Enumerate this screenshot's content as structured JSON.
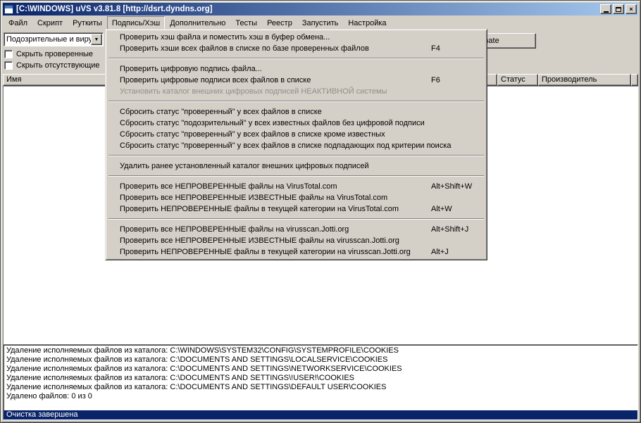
{
  "window": {
    "title": "[C:\\WINDOWS] uVS v3.81.8 [http://dsrt.dyndns.org]"
  },
  "icons": {
    "close": "×",
    "dropdown_arrow": "▼"
  },
  "colors": {
    "window_bg": "#d4d0c8",
    "titlebar_left": "#0a246a",
    "titlebar_right": "#a6caf0",
    "selection": "#0a246a"
  },
  "menubar": {
    "items": [
      "Файл",
      "Скрипт",
      "Руткиты",
      "Подпись/Хэш",
      "Дополнительно",
      "Тесты",
      "Реестр",
      "Запустить",
      "Настройка"
    ],
    "open_item": "Подпись/Хэш"
  },
  "toolbar": {
    "category_value": "Подозрительные и вирусы",
    "hide_checked_label": "Скрыть проверенные",
    "hide_checked_checked": false,
    "hide_missing_label": "Скрыть отсутствующие",
    "hide_missing_checked": false,
    "donate_label": "Donate"
  },
  "list": {
    "columns": [
      "Имя",
      "Статус",
      "Производитель"
    ],
    "rows": []
  },
  "hash_menu": {
    "items": [
      {
        "label": "Проверить хэш файла и поместить хэш в буфер обмена...",
        "shortcut": ""
      },
      {
        "label": "Проверить хэши всех файлов в списке по базе проверенных файлов",
        "shortcut": "F4"
      },
      {
        "label": "Проверить цифровую подпись файла...",
        "shortcut": ""
      },
      {
        "label": "Проверить цифровые подписи всех файлов в списке",
        "shortcut": "F6"
      },
      {
        "label": "Установить каталог внешних цифровых подписей НЕАКТИВНОЙ системы",
        "shortcut": "",
        "disabled": true
      },
      {
        "label": "Сбросить статус \"проверенный\" у всех файлов в списке",
        "shortcut": ""
      },
      {
        "label": "Сбросить статус \"подозрительный\" у всех известных файлов без цифровой подписи",
        "shortcut": ""
      },
      {
        "label": "Сбросить статус \"проверенный\" у всех файлов в списке кроме известных",
        "shortcut": ""
      },
      {
        "label": "Сбросить статус \"проверенный\" у всех файлов в списке подпадающих под критерии поиска",
        "shortcut": ""
      },
      {
        "label": "Удалить ранее установленный каталог внешних цифровых подписей",
        "shortcut": ""
      },
      {
        "label": "Проверить все НЕПРОВЕРЕННЫЕ файлы на VirusTotal.com",
        "shortcut": "Alt+Shift+W"
      },
      {
        "label": "Проверить все НЕПРОВЕРЕННЫЕ ИЗВЕСТНЫЕ файлы на VirusTotal.com",
        "shortcut": ""
      },
      {
        "label": "Проверить НЕПРОВЕРЕННЫЕ файлы в текущей категории на VirusTotal.com",
        "shortcut": "Alt+W"
      },
      {
        "label": "Проверить все НЕПРОВЕРЕННЫЕ файлы на virusscan.Jotti.org",
        "shortcut": "Alt+Shift+J"
      },
      {
        "label": "Проверить все НЕПРОВЕРЕННЫЕ ИЗВЕСТНЫЕ файлы на virusscan.Jotti.org",
        "shortcut": ""
      },
      {
        "label": "Проверить НЕПРОВЕРЕННЫЕ файлы в текущей категории на virusscan.Jotti.org",
        "shortcut": "Alt+J"
      }
    ]
  },
  "log": {
    "lines": [
      "Удаление исполняемых файлов из каталога: C:\\WINDOWS\\SYSTEM32\\CONFIG\\SYSTEMPROFILE\\COOKIES",
      "Удаление исполняемых файлов из каталога: C:\\DOCUMENTS AND SETTINGS\\LOCALSERVICE\\COOKIES",
      "Удаление исполняемых файлов из каталога: C:\\DOCUMENTS AND SETTINGS\\NETWORKSERVICE\\COOKIES",
      "Удаление исполняемых файлов из каталога: C:\\DOCUMENTS AND SETTINGS\\!USER!\\COOKIES",
      "Удаление исполняемых файлов из каталога: C:\\DOCUMENTS AND SETTINGS\\DEFAULT USER\\COOKIES",
      "Удалено файлов: 0 из 0"
    ],
    "selected_line": "Очистка завершена"
  }
}
